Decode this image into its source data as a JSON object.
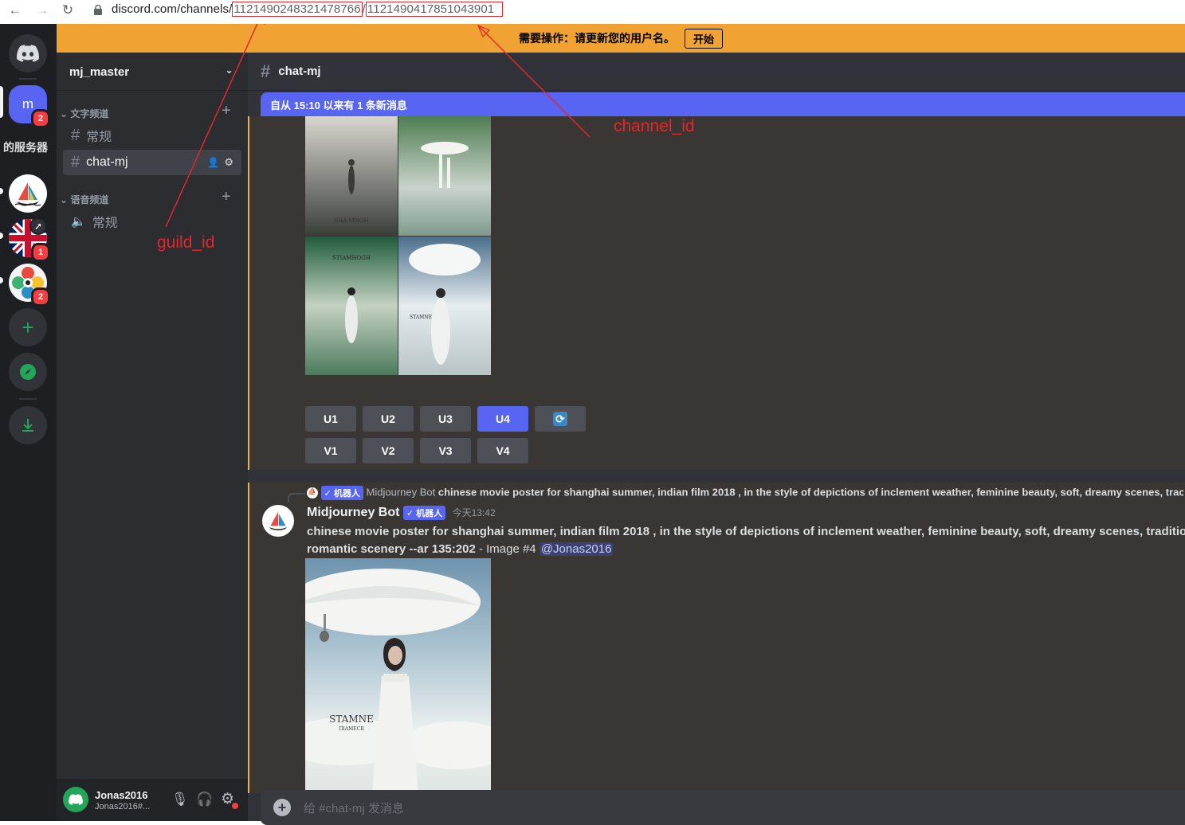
{
  "browser": {
    "url_prefix": "discord.com/channels/",
    "guild_id_value": "1121490248321478766",
    "separator": "/",
    "channel_id_value": "1121490417851043901",
    "back_icon": "arrow-left-icon",
    "forward_icon": "arrow-right-icon",
    "reload_icon": "reload-icon"
  },
  "banner": {
    "text": "需要操作：请更新您的用户名。",
    "button_label": "开始"
  },
  "guilds": {
    "m_label": "m",
    "m_badge": "2",
    "partial_label": "的服务器",
    "uk_badge": "1",
    "flower_badge": "2"
  },
  "server": {
    "name": "mj_master",
    "text_category": "文字频道",
    "voice_category": "语音频道",
    "channels": [
      "常规",
      "chat-mj"
    ],
    "voice_channels": [
      "常规"
    ]
  },
  "user": {
    "name": "Jonas2016",
    "tag": "Jonas2016#..."
  },
  "chat": {
    "channel_name": "chat-mj",
    "new_messages_bar": "自从 15:10 以来有 1 条新消息",
    "upscale_buttons": [
      "U1",
      "U2",
      "U3",
      "U4"
    ],
    "variation_buttons": [
      "V1",
      "V2",
      "V3",
      "V4"
    ],
    "grid_captions": [
      "SHA   MNGH",
      "STIAMHOGH",
      "STAMNE"
    ],
    "reply_tag": "✓ 机器人",
    "reply_author": "Midjourney Bot",
    "reply_preview": "chinese movie poster for shanghai summer, indian film 2018 , in the style of depictions of inclement weather, feminine beauty, soft, dreamy scenes, trac",
    "author": "Midjourney Bot",
    "bot_tag": "✓ 机器人",
    "timestamp": "今天13:42",
    "message_bold": "chinese movie poster for shanghai summer, indian film 2018 , in the style of depictions of inclement weather, feminine beauty, soft, dreamy scenes, traditiona",
    "message_line2_bold": "romantic scenery --ar 135:202",
    "message_suffix": " - Image #4 ",
    "mention": "@Jonas2016",
    "image_caption_line1": "STAMNE",
    "image_caption_line2": "ΠIAMECR",
    "composer_placeholder": "给 #chat-mj 发消息"
  },
  "annotations": {
    "guild_id": "guild_id",
    "channel_id": "channel_id"
  },
  "colors": {
    "banner": "#f0a232",
    "blurple": "#5865f2",
    "annotation": "#e0282d"
  }
}
